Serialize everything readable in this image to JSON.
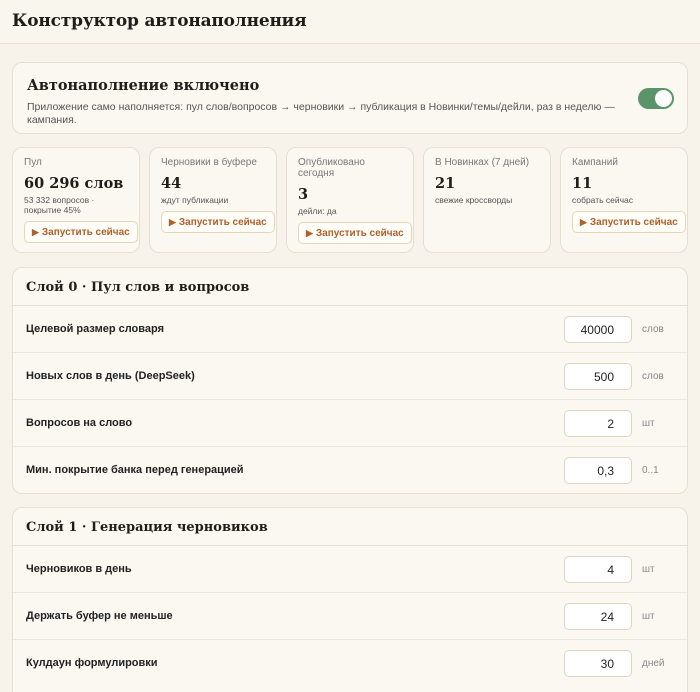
{
  "header": {
    "title": "Конструктор автонаполнения"
  },
  "autofill": {
    "title": "Автонаполнение включено",
    "description": "Приложение само наполняется: пул слов/вопросов → черновики → публикация в Новинки/темы/дейли, раз в неделю — кампания.",
    "enabled": true,
    "accent": "#5a9468"
  },
  "stats": [
    {
      "label": "Пул",
      "value": "60 296 слов",
      "sub": "53 332 вопросов · покрытие 45%",
      "action": "Запустить сейчас"
    },
    {
      "label": "Черновики в буфере",
      "value": "44",
      "sub": "ждут публикации",
      "action": "Запустить сейчас"
    },
    {
      "label": "Опубликовано сегодня",
      "value": "3",
      "sub": "дейли: да",
      "action": "Запустить сейчас"
    },
    {
      "label": "В Новинках (7 дней)",
      "value": "21",
      "sub": "свежие кроссворды"
    },
    {
      "label": "Кампаний",
      "value": "11",
      "sub": "собрать сейчас",
      "action": "Запустить сейчас"
    }
  ],
  "layer0": {
    "title": "Слой 0 · Пул слов и вопросов",
    "rows": [
      {
        "label": "Целевой размер словаря",
        "value": "40000",
        "unit": "слов"
      },
      {
        "label": "Новых слов в день (DeepSeek)",
        "value": "500",
        "unit": "слов"
      },
      {
        "label": "Вопросов на слово",
        "value": "2",
        "unit": "шт"
      },
      {
        "label": "Мин. покрытие банка перед генерацией",
        "value": "0,3",
        "unit": "0..1"
      }
    ]
  },
  "layer1": {
    "title": "Слой 1 · Генерация черновиков",
    "rows": [
      {
        "label": "Черновиков в день",
        "value": "4",
        "unit": "шт"
      },
      {
        "label": "Держать буфер не меньше",
        "value": "24",
        "unit": "шт"
      },
      {
        "label": "Кулдаун формулировки",
        "value": "30",
        "unit": "дней"
      }
    ]
  }
}
